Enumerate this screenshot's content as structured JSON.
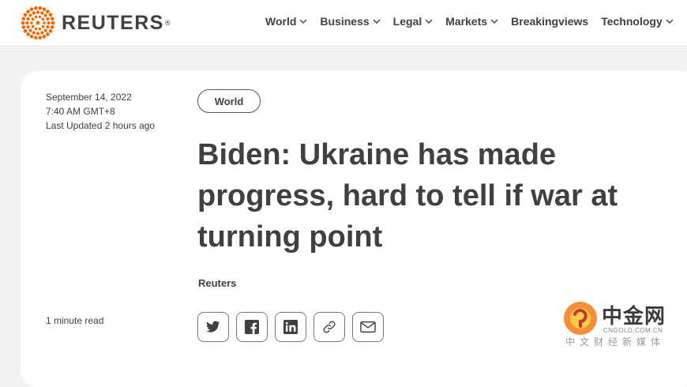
{
  "brand": {
    "name": "REUTERS",
    "reg": "®",
    "logo_icon": "reuters-dot-ring-logo"
  },
  "nav": {
    "items": [
      {
        "label": "World",
        "has_dropdown": true
      },
      {
        "label": "Business",
        "has_dropdown": true
      },
      {
        "label": "Legal",
        "has_dropdown": true
      },
      {
        "label": "Markets",
        "has_dropdown": true
      },
      {
        "label": "Breakingviews",
        "has_dropdown": false
      },
      {
        "label": "Technology",
        "has_dropdown": true
      }
    ]
  },
  "article": {
    "date": "September 14, 2022",
    "time": "7:40 AM GMT+8",
    "updated": "Last Updated 2 hours ago",
    "read_time": "1 minute read",
    "tag": "World",
    "headline": "Biden: Ukraine has made progress, hard to tell if war at turning point",
    "byline": "Reuters"
  },
  "share": {
    "buttons": [
      "twitter-icon",
      "facebook-icon",
      "linkedin-icon",
      "link-icon",
      "email-icon"
    ]
  },
  "watermark": {
    "title": "中金网",
    "url": "CNGOLD.COM.CN",
    "subtitle": "中文财经新媒体"
  },
  "colors": {
    "text": "#404040",
    "brand_orange": "#fa6400",
    "background": "#f2f2f2"
  }
}
